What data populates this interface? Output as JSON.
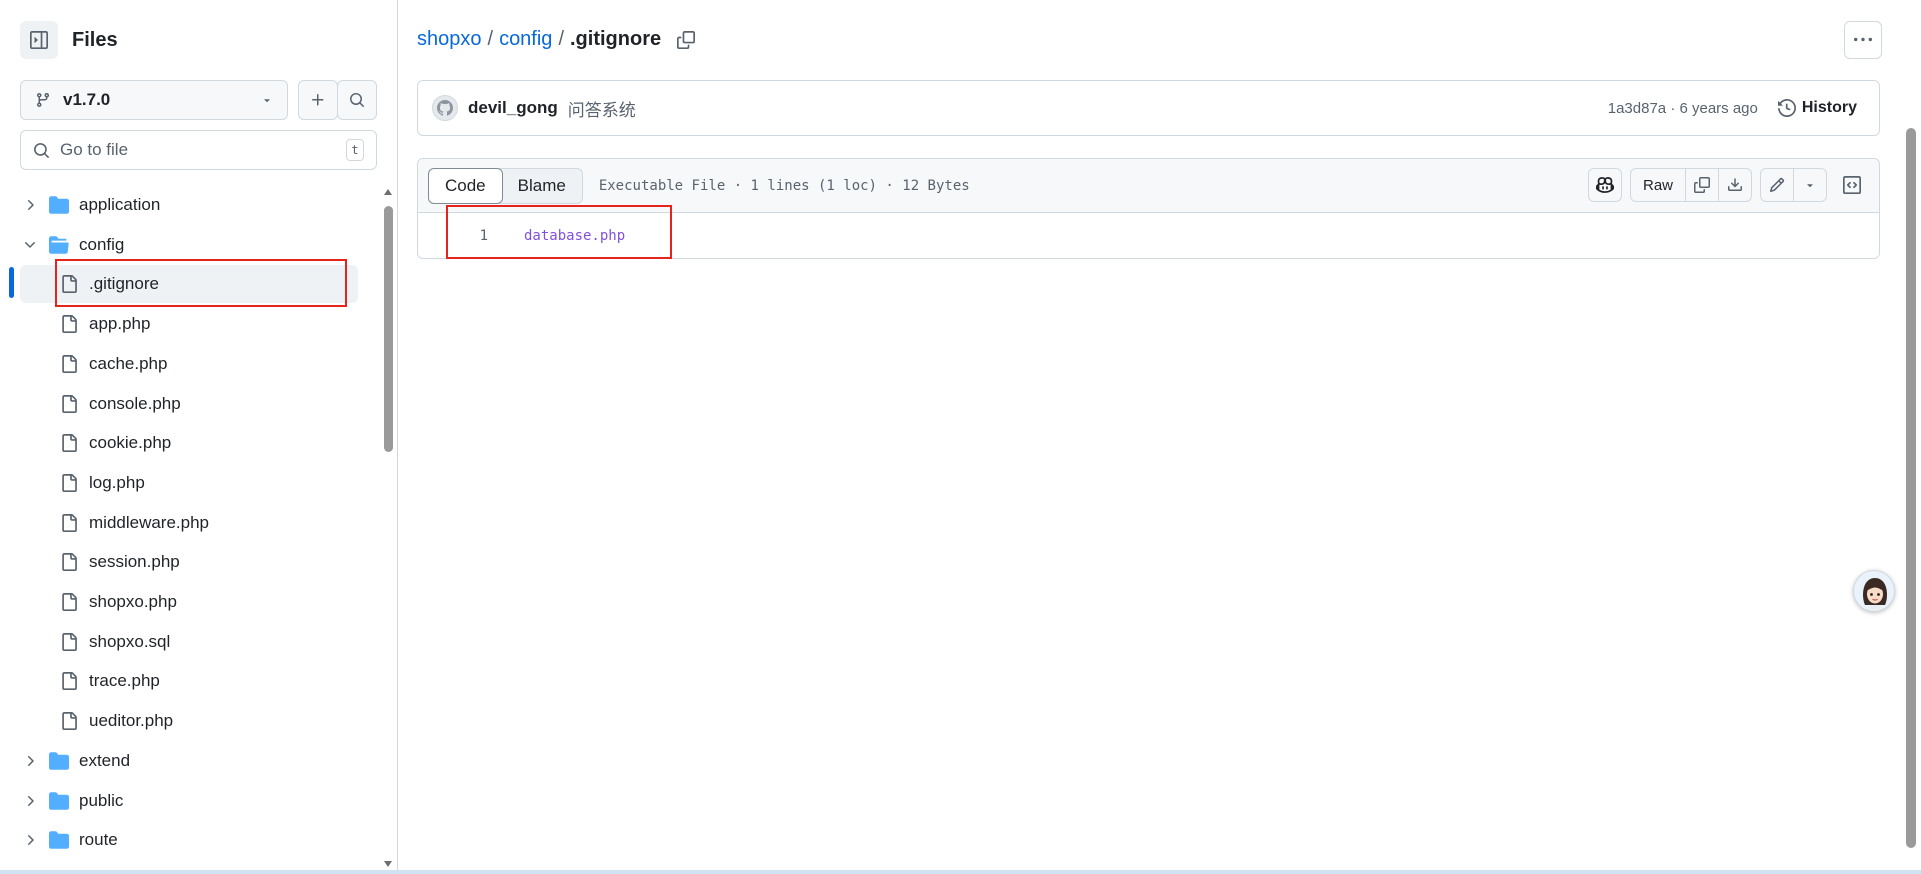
{
  "sidebar": {
    "title": "Files",
    "branch": "v1.7.0",
    "goto_placeholder": "Go to file",
    "goto_shortcut": "t",
    "tree": [
      {
        "name": "application",
        "type": "folder",
        "expanded": false,
        "depth": 0
      },
      {
        "name": "config",
        "type": "folder",
        "expanded": true,
        "depth": 0
      },
      {
        "name": ".gitignore",
        "type": "file",
        "depth": 1,
        "selected": true
      },
      {
        "name": "app.php",
        "type": "file",
        "depth": 1
      },
      {
        "name": "cache.php",
        "type": "file",
        "depth": 1
      },
      {
        "name": "console.php",
        "type": "file",
        "depth": 1
      },
      {
        "name": "cookie.php",
        "type": "file",
        "depth": 1
      },
      {
        "name": "log.php",
        "type": "file",
        "depth": 1
      },
      {
        "name": "middleware.php",
        "type": "file",
        "depth": 1
      },
      {
        "name": "session.php",
        "type": "file",
        "depth": 1
      },
      {
        "name": "shopxo.php",
        "type": "file",
        "depth": 1
      },
      {
        "name": "shopxo.sql",
        "type": "file",
        "depth": 1
      },
      {
        "name": "trace.php",
        "type": "file",
        "depth": 1
      },
      {
        "name": "ueditor.php",
        "type": "file",
        "depth": 1
      },
      {
        "name": "extend",
        "type": "folder",
        "expanded": false,
        "depth": 0
      },
      {
        "name": "public",
        "type": "folder",
        "expanded": false,
        "depth": 0
      },
      {
        "name": "route",
        "type": "folder",
        "expanded": false,
        "depth": 0
      }
    ]
  },
  "breadcrumb": {
    "repo": "shopxo",
    "folder": "config",
    "file": ".gitignore",
    "sep": "/"
  },
  "commit": {
    "author": "devil_gong",
    "message": "问答系统",
    "sha_age": "1a3d87a · 6 years ago",
    "history_label": "History"
  },
  "file": {
    "tab_code": "Code",
    "tab_blame": "Blame",
    "meta": "Executable File · 1 lines (1 loc) · 12 Bytes",
    "raw_label": "Raw",
    "lines": [
      {
        "num": "1",
        "text": "database.php"
      }
    ]
  },
  "colors": {
    "accent": "#0969da",
    "highlight_box": "#e5241d",
    "code_text": "#8250df",
    "folder": "#54aeff"
  }
}
